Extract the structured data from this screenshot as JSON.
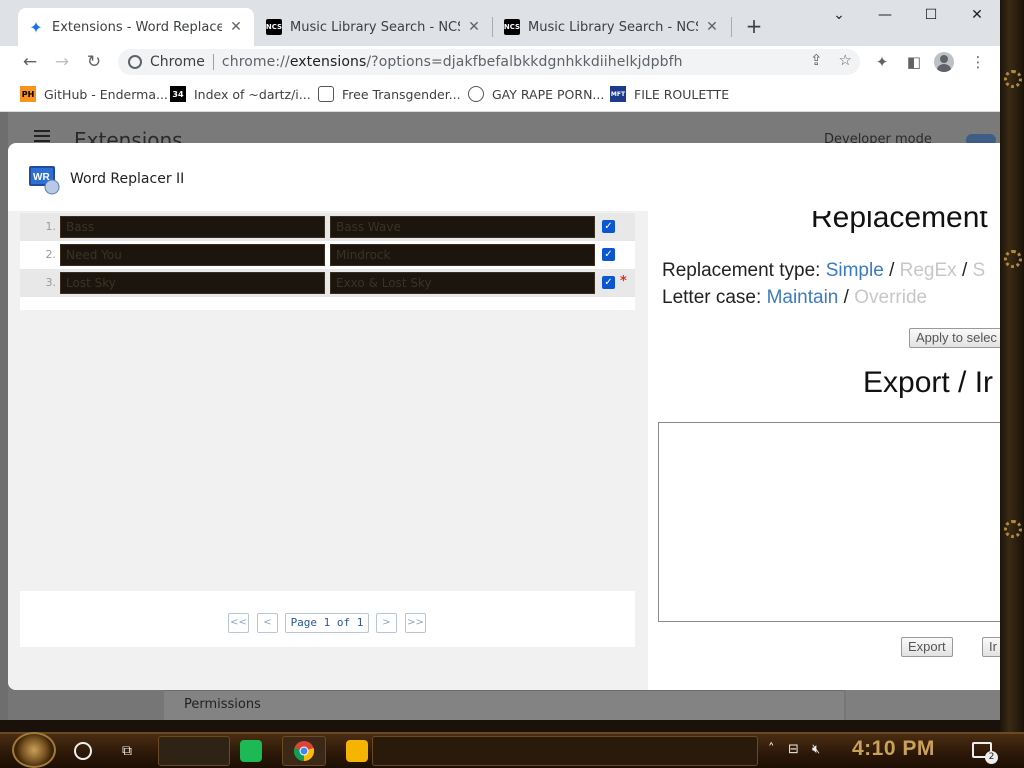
{
  "browser": {
    "tabs": [
      {
        "title": "Extensions - Word Replacer II",
        "icon": "puzzle-icon",
        "active": true
      },
      {
        "title": "Music Library Search - NCS",
        "icon": "ncs-icon",
        "active": false
      },
      {
        "title": "Music Library Search - NCS",
        "icon": "ncs-icon",
        "active": false
      }
    ],
    "ncs_icon_text": "NCS",
    "omnibox": {
      "site_label": "Chrome",
      "url_prefix": "chrome://",
      "url_host": "extensions",
      "url_rest": "/?options=djakfbefalbkkdgnhkkdiihelkjdpbfh"
    },
    "bookmarks": [
      {
        "label": "GitHub - Enderma...",
        "icon": "PH"
      },
      {
        "label": "Index of ~dartz/i...",
        "icon": "34"
      },
      {
        "label": "Free Transgender...",
        "icon": "globe"
      },
      {
        "label": "GAY RAPE PORN...",
        "icon": "globe"
      },
      {
        "label": "FILE ROULETTE",
        "icon": "MFT"
      }
    ]
  },
  "background_page": {
    "title": "Extensions",
    "developer_mode_label": "Developer mode",
    "permissions_label": "Permissions"
  },
  "dialog": {
    "title": "Word Replacer II",
    "logo_text": "WR",
    "rows": [
      {
        "num": "1.",
        "find": "Bass",
        "replace": "Bass Wave",
        "checked": true,
        "modified": false
      },
      {
        "num": "2.",
        "find": "Need You",
        "replace": "Mindrock",
        "checked": true,
        "modified": false
      },
      {
        "num": "3.",
        "find": "Lost Sky",
        "replace": "Exxo & Lost Sky",
        "checked": true,
        "modified": true
      }
    ],
    "pager": {
      "first": "<<",
      "prev": "<",
      "label": "Page 1 of 1",
      "next": ">",
      "last": ">>"
    },
    "right": {
      "replacement_heading": "Replacement",
      "replacement_type_label": "Replacement type:",
      "type_simple": "Simple",
      "type_regex": "RegEx",
      "type_third": "S",
      "letter_case_label": "Letter case:",
      "case_maintain": "Maintain",
      "case_override": "Override",
      "slash": "/",
      "apply_button": "Apply to selec",
      "export_heading": "Export / Ir",
      "export_button": "Export",
      "import_button": "Ir"
    }
  },
  "taskbar": {
    "clock": "4:10 PM",
    "notification_count": "2"
  }
}
